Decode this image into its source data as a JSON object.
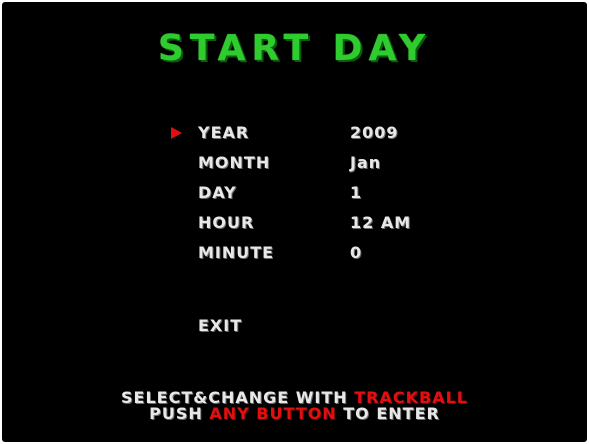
{
  "title": "START DAY",
  "menu": {
    "items": [
      {
        "label": "YEAR",
        "value": "2009"
      },
      {
        "label": "MONTH",
        "value": "Jan"
      },
      {
        "label": "DAY",
        "value": "1"
      },
      {
        "label": "HOUR",
        "value": "12 AM"
      },
      {
        "label": "MINUTE",
        "value": "0"
      }
    ],
    "exit_label": "EXIT",
    "selected_index": 0
  },
  "footer": {
    "line1_prefix": "SELECT&CHANGE WITH ",
    "line1_highlight": "TRACKBALL",
    "line2_prefix": "PUSH ",
    "line2_highlight": "ANY BUTTON",
    "line2_suffix": " TO ENTER"
  },
  "colors": {
    "background": "#000000",
    "title": "#2ecc2e",
    "text": "#e8e8e8",
    "highlight": "#e01010",
    "cursor": "#e01010"
  },
  "icons": {
    "cursor": "red-triangle-cursor-icon"
  }
}
